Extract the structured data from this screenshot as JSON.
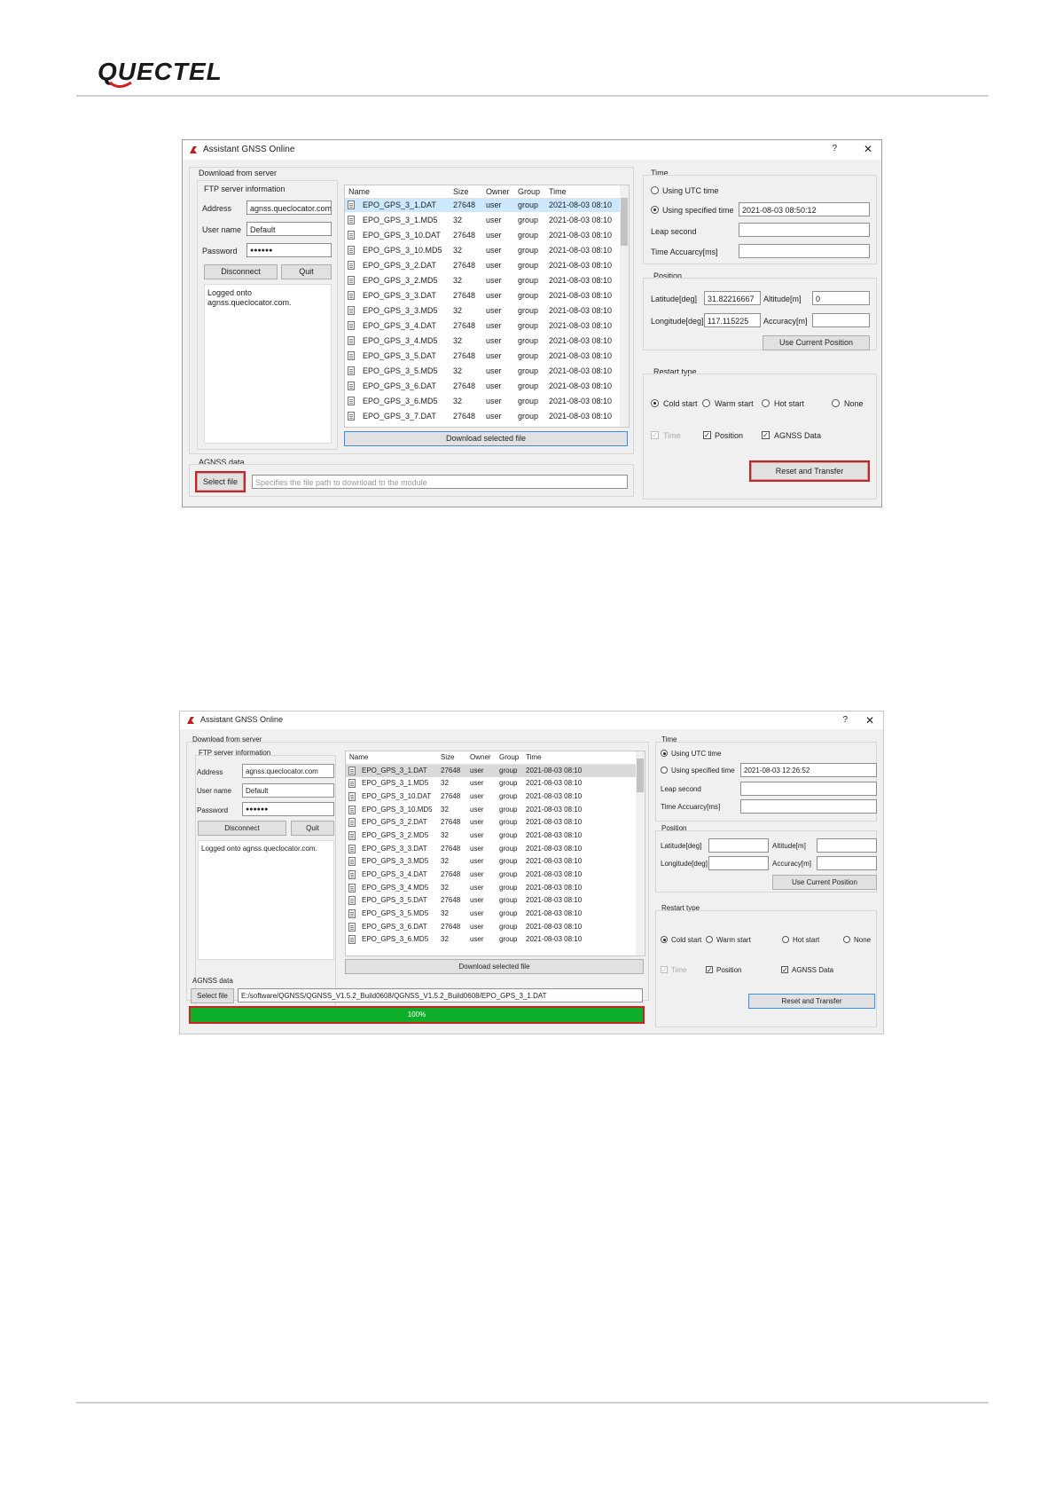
{
  "brand": {
    "logo_text": "QUECTEL"
  },
  "w1": {
    "title": "Assistant GNSS Online",
    "help": "?",
    "close": "✕",
    "download_group": "Download from server",
    "ftp_group": "FTP server information",
    "address_label": "Address",
    "address_value": "agnss.queclocator.com",
    "username_label": "User name",
    "username_value": "Default",
    "password_label": "Password",
    "password_value": "●●●●●●",
    "disconnect": "Disconnect",
    "quit": "Quit",
    "log": "Logged onto agnss.queclocator.com.",
    "columns": [
      "Name",
      "Size",
      "Owner",
      "Group",
      "Time"
    ],
    "files": [
      [
        "EPO_GPS_3_1.DAT",
        "27648",
        "user",
        "group",
        "2021-08-03 08:10"
      ],
      [
        "EPO_GPS_3_1.MD5",
        "32",
        "user",
        "group",
        "2021-08-03 08:10"
      ],
      [
        "EPO_GPS_3_10.DAT",
        "27648",
        "user",
        "group",
        "2021-08-03 08:10"
      ],
      [
        "EPO_GPS_3_10.MD5",
        "32",
        "user",
        "group",
        "2021-08-03 08:10"
      ],
      [
        "EPO_GPS_3_2.DAT",
        "27648",
        "user",
        "group",
        "2021-08-03 08:10"
      ],
      [
        "EPO_GPS_3_2.MD5",
        "32",
        "user",
        "group",
        "2021-08-03 08:10"
      ],
      [
        "EPO_GPS_3_3.DAT",
        "27648",
        "user",
        "group",
        "2021-08-03 08:10"
      ],
      [
        "EPO_GPS_3_3.MD5",
        "32",
        "user",
        "group",
        "2021-08-03 08:10"
      ],
      [
        "EPO_GPS_3_4.DAT",
        "27648",
        "user",
        "group",
        "2021-08-03 08:10"
      ],
      [
        "EPO_GPS_3_4.MD5",
        "32",
        "user",
        "group",
        "2021-08-03 08:10"
      ],
      [
        "EPO_GPS_3_5.DAT",
        "27648",
        "user",
        "group",
        "2021-08-03 08:10"
      ],
      [
        "EPO_GPS_3_5.MD5",
        "32",
        "user",
        "group",
        "2021-08-03 08:10"
      ],
      [
        "EPO_GPS_3_6.DAT",
        "27648",
        "user",
        "group",
        "2021-08-03 08:10"
      ],
      [
        "EPO_GPS_3_6.MD5",
        "32",
        "user",
        "group",
        "2021-08-03 08:10"
      ],
      [
        "EPO_GPS_3_7.DAT",
        "27648",
        "user",
        "group",
        "2021-08-03 08:10"
      ]
    ],
    "download_btn": "Download selected file",
    "agnss_group": "AGNSS data",
    "select_file": "Select file",
    "path_placeholder": "Specifies the file path to download to the module",
    "time_group": "Time",
    "utc_label": "Using UTC time",
    "specified_label": "Using specified time",
    "specified_value": "2021-08-03 08:50:12",
    "leap_label": "Leap second",
    "accuracy_label": "Time Accuarcy[ms]",
    "position_group": "Position",
    "lat_label": "Latitude[deg]",
    "lat_value": "31.82216667",
    "alt_label": "Altitude[m]",
    "alt_value": "0",
    "lon_label": "Longitude[deg]",
    "lon_value": "117.115225",
    "pos_acc_label": "Accuracy[m]",
    "use_position": "Use Current Position",
    "restart_group": "Restart type",
    "cold": "Cold start",
    "warm": "Warm start",
    "hot": "Hot start",
    "none": "None",
    "time_chk": "Time",
    "position_chk": "Position",
    "agnss_chk": "AGNSS Data",
    "reset": "Reset and Transfer"
  },
  "w2": {
    "title": "Assistant GNSS Online",
    "help": "?",
    "close": "✕",
    "download_group": "Download from server",
    "ftp_group": "FTP server information",
    "address_label": "Address",
    "address_value": "agnss.queclocator.com",
    "username_label": "User name",
    "username_value": "Default",
    "password_label": "Password",
    "password_value": "●●●●●●",
    "disconnect": "Disconnect",
    "quit": "Quit",
    "log": "Logged onto agnss.queclocator.com.",
    "columns": [
      "Name",
      "Size",
      "Owner",
      "Group",
      "Time"
    ],
    "files": [
      [
        "EPO_GPS_3_1.DAT",
        "27648",
        "user",
        "group",
        "2021-08-03 08:10"
      ],
      [
        "EPO_GPS_3_1.MD5",
        "32",
        "user",
        "group",
        "2021-08-03 08:10"
      ],
      [
        "EPO_GPS_3_10.DAT",
        "27648",
        "user",
        "group",
        "2021-08-03 08:10"
      ],
      [
        "EPO_GPS_3_10.MD5",
        "32",
        "user",
        "group",
        "2021-08-03 08:10"
      ],
      [
        "EPO_GPS_3_2.DAT",
        "27648",
        "user",
        "group",
        "2021-08-03 08:10"
      ],
      [
        "EPO_GPS_3_2.MD5",
        "32",
        "user",
        "group",
        "2021-08-03 08:10"
      ],
      [
        "EPO_GPS_3_3.DAT",
        "27648",
        "user",
        "group",
        "2021-08-03 08:10"
      ],
      [
        "EPO_GPS_3_3.MD5",
        "32",
        "user",
        "group",
        "2021-08-03 08:10"
      ],
      [
        "EPO_GPS_3_4.DAT",
        "27648",
        "user",
        "group",
        "2021-08-03 08:10"
      ],
      [
        "EPO_GPS_3_4.MD5",
        "32",
        "user",
        "group",
        "2021-08-03 08:10"
      ],
      [
        "EPO_GPS_3_5.DAT",
        "27648",
        "user",
        "group",
        "2021-08-03 08:10"
      ],
      [
        "EPO_GPS_3_5.MD5",
        "32",
        "user",
        "group",
        "2021-08-03 08:10"
      ],
      [
        "EPO_GPS_3_6.DAT",
        "27648",
        "user",
        "group",
        "2021-08-03 08:10"
      ],
      [
        "EPO_GPS_3_6.MD5",
        "32",
        "user",
        "group",
        "2021-08-03 08:10"
      ]
    ],
    "download_btn": "Download selected file",
    "agnss_group": "AGNSS data",
    "select_file": "Select file",
    "path_value": "E:/software/QGNSS/QGNSS_V1.5.2_Build0608/QGNSS_V1.5.2_Build0608/EPO_GPS_3_1.DAT",
    "progress_text": "100%",
    "progress_value": 100,
    "time_group": "Time",
    "utc_label": "Using UTC time",
    "specified_label": "Using specified time",
    "specified_value": "2021-08-03 12:26:52",
    "leap_label": "Leap second",
    "accuracy_label": "Time Accuarcy[ms]",
    "position_group": "Position",
    "lat_label": "Latitude[deg]",
    "alt_label": "Altitude[m]",
    "lon_label": "Longitude[deg]",
    "pos_acc_label": "Accuracy[m]",
    "use_position": "Use Current Position",
    "restart_group": "Restart type",
    "cold": "Cold start",
    "warm": "Warm start",
    "hot": "Hot start",
    "none": "None",
    "time_chk": "Time",
    "position_chk": "Position",
    "agnss_chk": "AGNSS Data",
    "reset": "Reset and Transfer"
  },
  "colors": {
    "brand": "#1a1a1a",
    "accent_red": "#d21f1f",
    "progress_green": "#0fae2a",
    "selection": "#cce8ff"
  }
}
